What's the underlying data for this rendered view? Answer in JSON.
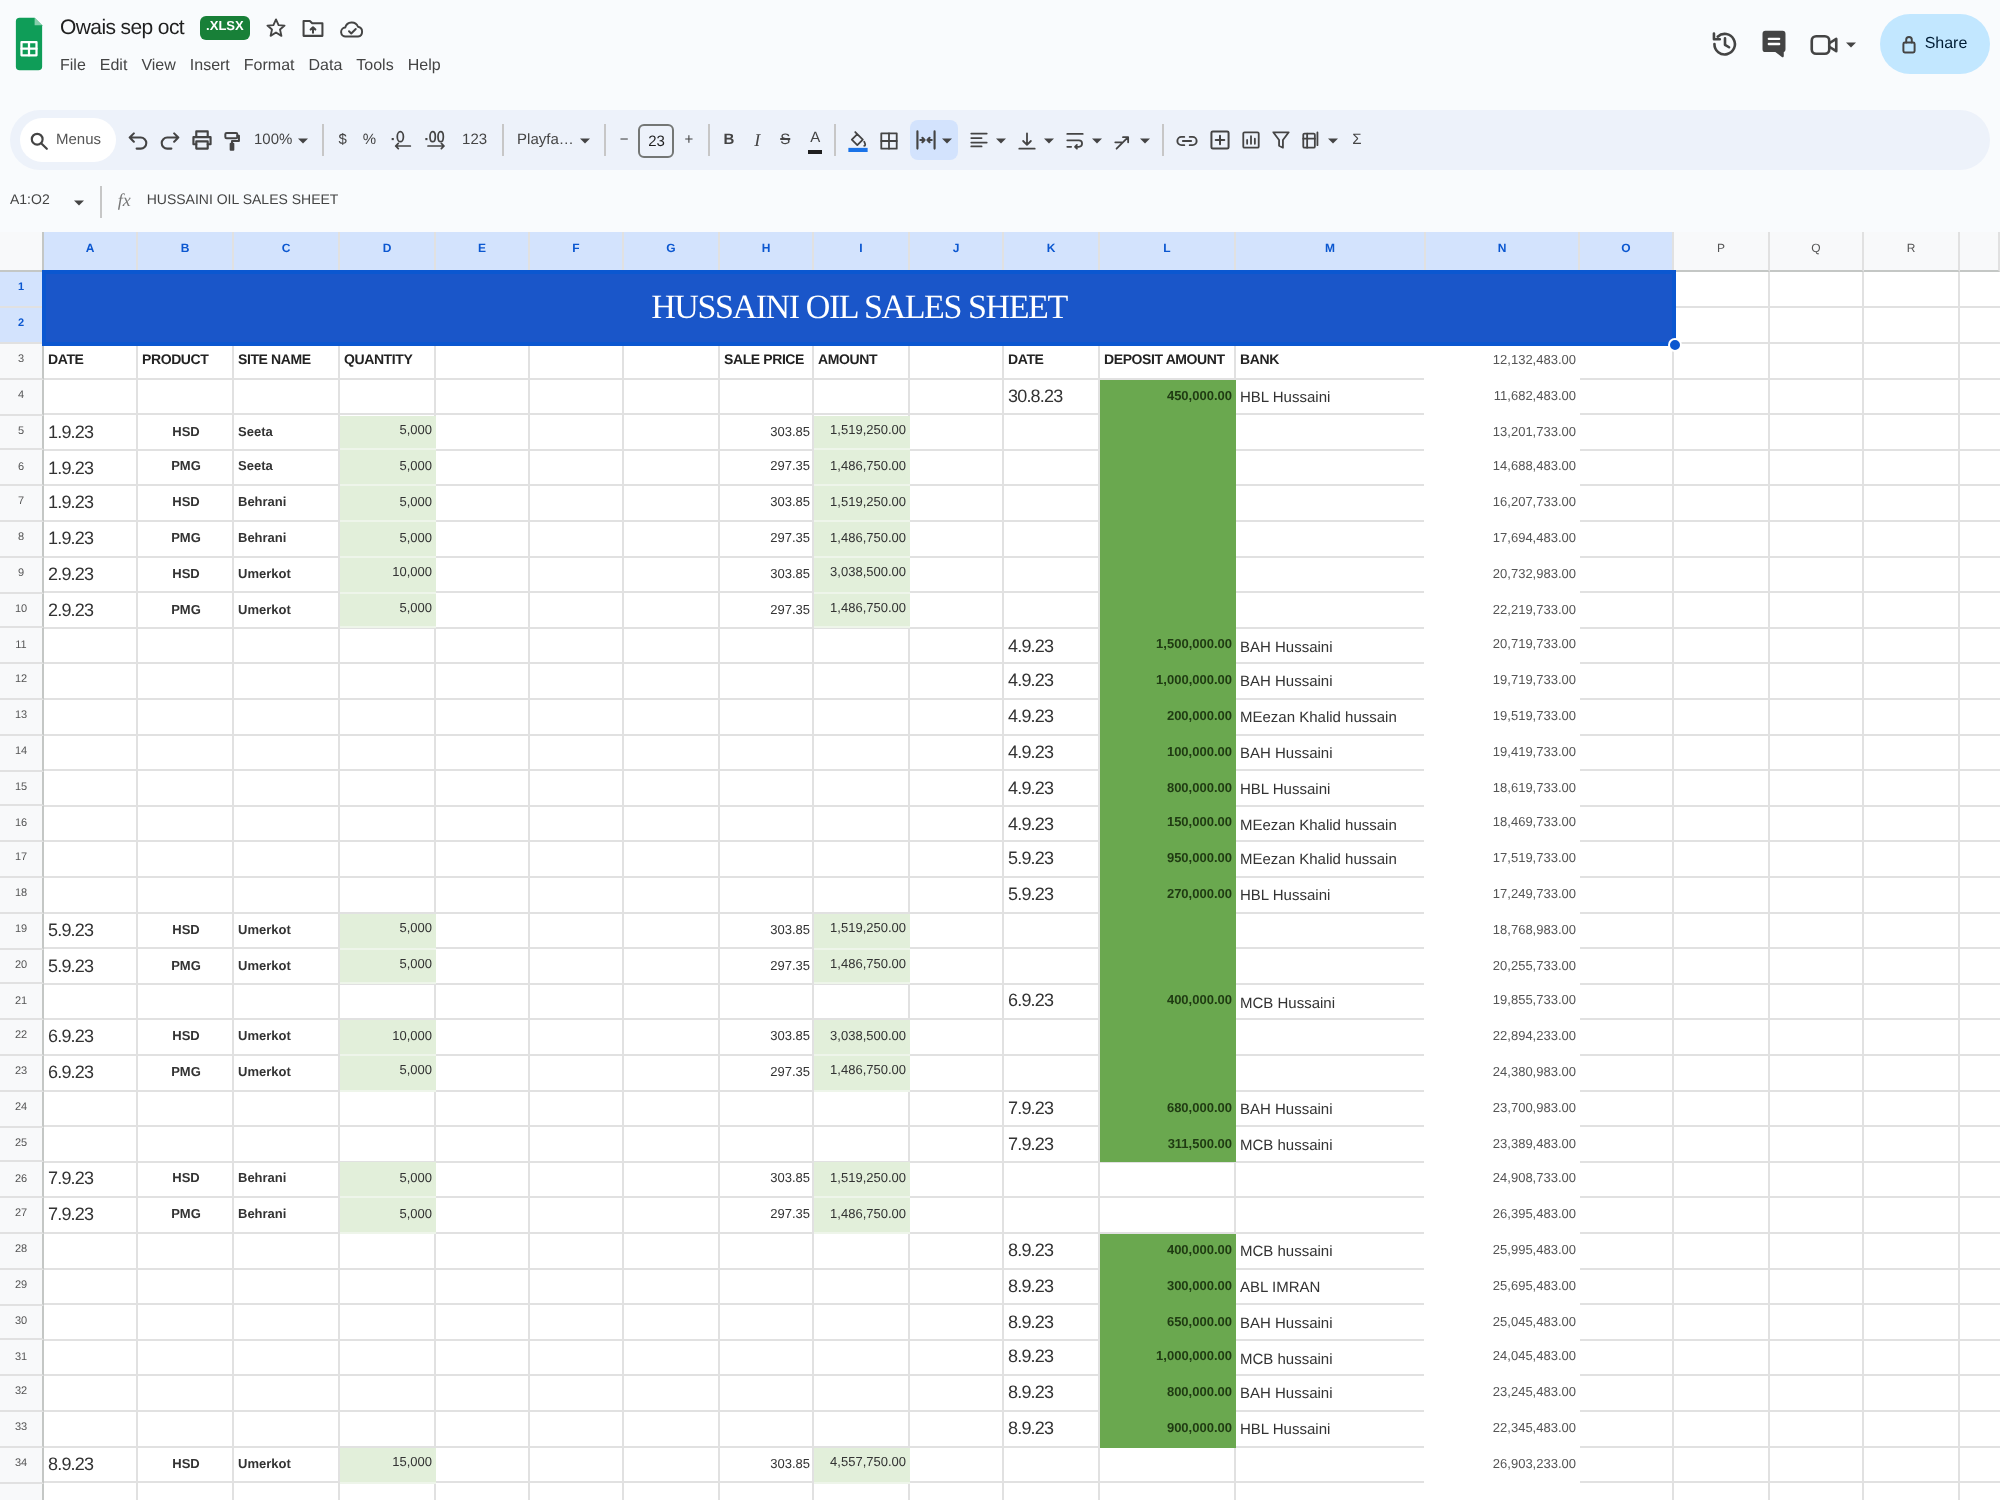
{
  "document": {
    "title": "Owais sep oct",
    "file_type": ".XLSX"
  },
  "menu": [
    "File",
    "Edit",
    "View",
    "Insert",
    "Format",
    "Data",
    "Tools",
    "Help"
  ],
  "share_button": "Share",
  "toolbar": {
    "search": {
      "placeholder": "Menus"
    },
    "zoom": "100%",
    "currency": "$",
    "percent": "%",
    "number_format": "123",
    "font": "Playfa…",
    "font_size": {
      "decrease": "−",
      "value": "23",
      "increase": "+"
    },
    "text_styles": [
      {
        "kind": "bold",
        "label": "B"
      },
      {
        "kind": "italic",
        "label": "I"
      },
      {
        "kind": "strikethrough",
        "label": "S"
      },
      {
        "kind": "text_color",
        "label": "A"
      }
    ],
    "merge": {
      "selected": true
    },
    "sum": "Σ"
  },
  "formula_bar": {
    "cell_range": "A1:O2",
    "fx": "fx",
    "formula": "HUSSAINI OIL SALES SHEET"
  },
  "sheet": {
    "columns": [
      {
        "label": "A",
        "selected": true
      },
      {
        "label": "B",
        "selected": true
      },
      {
        "label": "C",
        "selected": true
      },
      {
        "label": "D",
        "selected": true
      },
      {
        "label": "E",
        "selected": true
      },
      {
        "label": "F",
        "selected": true
      },
      {
        "label": "G",
        "selected": true
      },
      {
        "label": "H",
        "selected": true
      },
      {
        "label": "I",
        "selected": true
      },
      {
        "label": "J",
        "selected": true
      },
      {
        "label": "K",
        "selected": true
      },
      {
        "label": "L",
        "selected": true
      },
      {
        "label": "M",
        "selected": true
      },
      {
        "label": "N",
        "selected": true
      },
      {
        "label": "O",
        "selected": true
      },
      {
        "label": "P",
        "selected": false
      },
      {
        "label": "Q",
        "selected": false
      },
      {
        "label": "R",
        "selected": false
      }
    ],
    "title_band": {
      "text": "HUSSAINI OIL SALES SHEET",
      "selected": true
    },
    "title_rows": [
      {
        "number": "1",
        "selected": true
      },
      {
        "number": "2",
        "selected": true
      }
    ],
    "rows": [
      {
        "number": "3",
        "selected": false,
        "kind": "heading",
        "sale": {
          "date": "DATE",
          "product": "PRODUCT",
          "site": "SITE NAME",
          "quantity": "QUANTITY",
          "sale_price": "SALE PRICE",
          "amount": "AMOUNT"
        },
        "deposit": {
          "date": "DATE",
          "amount": "DEPOSIT AMOUNT",
          "bank": "BANK"
        },
        "deposit_filled": false,
        "balance": "12,132,483.00"
      },
      {
        "number": "4",
        "selected": false,
        "kind": "entry",
        "deposit": {
          "date": "30.8.23",
          "amount": "450,000.00",
          "bank": "HBL Hussaini"
        },
        "deposit_filled": true,
        "balance": "11,682,483.00"
      },
      {
        "number": "5",
        "selected": false,
        "kind": "entry",
        "sale": {
          "date": "1.9.23",
          "product": "HSD",
          "site": "Seeta",
          "quantity": "5,000",
          "sale_price": "303.85",
          "amount": "1,519,250.00"
        },
        "deposit_filled": true,
        "balance": "13,201,733.00"
      },
      {
        "number": "6",
        "selected": false,
        "kind": "entry",
        "sale": {
          "date": "1.9.23",
          "product": "PMG",
          "site": "Seeta",
          "quantity": "5,000",
          "sale_price": "297.35",
          "amount": "1,486,750.00"
        },
        "deposit_filled": true,
        "balance": "14,688,483.00"
      },
      {
        "number": "7",
        "selected": false,
        "kind": "entry",
        "sale": {
          "date": "1.9.23",
          "product": "HSD",
          "site": "Behrani",
          "quantity": "5,000",
          "sale_price": "303.85",
          "amount": "1,519,250.00"
        },
        "deposit_filled": true,
        "balance": "16,207,733.00"
      },
      {
        "number": "8",
        "selected": false,
        "kind": "entry",
        "sale": {
          "date": "1.9.23",
          "product": "PMG",
          "site": "Behrani",
          "quantity": "5,000",
          "sale_price": "297.35",
          "amount": "1,486,750.00"
        },
        "deposit_filled": true,
        "balance": "17,694,483.00"
      },
      {
        "number": "9",
        "selected": false,
        "kind": "entry",
        "sale": {
          "date": "2.9.23",
          "product": "HSD",
          "site": "Umerkot",
          "quantity": "10,000",
          "sale_price": "303.85",
          "amount": "3,038,500.00"
        },
        "deposit_filled": true,
        "balance": "20,732,983.00"
      },
      {
        "number": "10",
        "selected": false,
        "kind": "entry",
        "sale": {
          "date": "2.9.23",
          "product": "PMG",
          "site": "Umerkot",
          "quantity": "5,000",
          "sale_price": "297.35",
          "amount": "1,486,750.00"
        },
        "deposit_filled": true,
        "balance": "22,219,733.00"
      },
      {
        "number": "11",
        "selected": false,
        "kind": "entry",
        "deposit": {
          "date": "4.9.23",
          "amount": "1,500,000.00",
          "bank": "BAH Hussaini"
        },
        "deposit_filled": true,
        "balance": "20,719,733.00"
      },
      {
        "number": "12",
        "selected": false,
        "kind": "entry",
        "deposit": {
          "date": "4.9.23",
          "amount": "1,000,000.00",
          "bank": "BAH Hussaini"
        },
        "deposit_filled": true,
        "balance": "19,719,733.00"
      },
      {
        "number": "13",
        "selected": false,
        "kind": "entry",
        "deposit": {
          "date": "4.9.23",
          "amount": "200,000.00",
          "bank": "MEezan Khalid hussain"
        },
        "deposit_filled": true,
        "balance": "19,519,733.00"
      },
      {
        "number": "14",
        "selected": false,
        "kind": "entry",
        "deposit": {
          "date": "4.9.23",
          "amount": "100,000.00",
          "bank": "BAH Hussaini"
        },
        "deposit_filled": true,
        "balance": "19,419,733.00"
      },
      {
        "number": "15",
        "selected": false,
        "kind": "entry",
        "deposit": {
          "date": "4.9.23",
          "amount": "800,000.00",
          "bank": "HBL Hussaini"
        },
        "deposit_filled": true,
        "balance": "18,619,733.00"
      },
      {
        "number": "16",
        "selected": false,
        "kind": "entry",
        "deposit": {
          "date": "4.9.23",
          "amount": "150,000.00",
          "bank": "MEezan Khalid hussain"
        },
        "deposit_filled": true,
        "balance": "18,469,733.00"
      },
      {
        "number": "17",
        "selected": false,
        "kind": "entry",
        "deposit": {
          "date": "5.9.23",
          "amount": "950,000.00",
          "bank": "MEezan Khalid hussain"
        },
        "deposit_filled": true,
        "balance": "17,519,733.00"
      },
      {
        "number": "18",
        "selected": false,
        "kind": "entry",
        "deposit": {
          "date": "5.9.23",
          "amount": "270,000.00",
          "bank": "HBL Hussaini"
        },
        "deposit_filled": true,
        "balance": "17,249,733.00"
      },
      {
        "number": "19",
        "selected": false,
        "kind": "entry",
        "sale": {
          "date": "5.9.23",
          "product": "HSD",
          "site": "Umerkot",
          "quantity": "5,000",
          "sale_price": "303.85",
          "amount": "1,519,250.00"
        },
        "deposit_filled": true,
        "balance": "18,768,983.00"
      },
      {
        "number": "20",
        "selected": false,
        "kind": "entry",
        "sale": {
          "date": "5.9.23",
          "product": "PMG",
          "site": "Umerkot",
          "quantity": "5,000",
          "sale_price": "297.35",
          "amount": "1,486,750.00"
        },
        "deposit_filled": true,
        "balance": "20,255,733.00"
      },
      {
        "number": "21",
        "selected": false,
        "kind": "entry",
        "deposit": {
          "date": "6.9.23",
          "amount": "400,000.00",
          "bank": "MCB Hussaini"
        },
        "deposit_filled": true,
        "balance": "19,855,733.00"
      },
      {
        "number": "22",
        "selected": false,
        "kind": "entry",
        "sale": {
          "date": "6.9.23",
          "product": "HSD",
          "site": "Umerkot",
          "quantity": "10,000",
          "sale_price": "303.85",
          "amount": "3,038,500.00"
        },
        "deposit_filled": true,
        "balance": "22,894,233.00"
      },
      {
        "number": "23",
        "selected": false,
        "kind": "entry",
        "sale": {
          "date": "6.9.23",
          "product": "PMG",
          "site": "Umerkot",
          "quantity": "5,000",
          "sale_price": "297.35",
          "amount": "1,486,750.00"
        },
        "deposit_filled": true,
        "balance": "24,380,983.00"
      },
      {
        "number": "24",
        "selected": false,
        "kind": "entry",
        "deposit": {
          "date": "7.9.23",
          "amount": "680,000.00",
          "bank": "BAH Hussaini"
        },
        "deposit_filled": true,
        "balance": "23,700,983.00"
      },
      {
        "number": "25",
        "selected": false,
        "kind": "entry",
        "deposit": {
          "date": "7.9.23",
          "amount": "311,500.00",
          "bank": "MCB hussaini"
        },
        "deposit_filled": true,
        "balance": "23,389,483.00"
      },
      {
        "number": "26",
        "selected": false,
        "kind": "entry",
        "sale": {
          "date": "7.9.23",
          "product": "HSD",
          "site": "Behrani",
          "quantity": "5,000",
          "sale_price": "303.85",
          "amount": "1,519,250.00"
        },
        "deposit_filled": false,
        "balance": "24,908,733.00"
      },
      {
        "number": "27",
        "selected": false,
        "kind": "entry",
        "sale": {
          "date": "7.9.23",
          "product": "PMG",
          "site": "Behrani",
          "quantity": "5,000",
          "sale_price": "297.35",
          "amount": "1,486,750.00"
        },
        "deposit_filled": false,
        "balance": "26,395,483.00"
      },
      {
        "number": "28",
        "selected": false,
        "kind": "entry",
        "deposit": {
          "date": "8.9.23",
          "amount": "400,000.00",
          "bank": "MCB hussaini"
        },
        "deposit_filled": true,
        "balance": "25,995,483.00"
      },
      {
        "number": "29",
        "selected": false,
        "kind": "entry",
        "deposit": {
          "date": "8.9.23",
          "amount": "300,000.00",
          "bank": "ABL IMRAN"
        },
        "deposit_filled": true,
        "balance": "25,695,483.00"
      },
      {
        "number": "30",
        "selected": false,
        "kind": "entry",
        "deposit": {
          "date": "8.9.23",
          "amount": "650,000.00",
          "bank": "BAH Hussaini"
        },
        "deposit_filled": true,
        "balance": "25,045,483.00"
      },
      {
        "number": "31",
        "selected": false,
        "kind": "entry",
        "deposit": {
          "date": "8.9.23",
          "amount": "1,000,000.00",
          "bank": "MCB hussaini"
        },
        "deposit_filled": true,
        "balance": "24,045,483.00"
      },
      {
        "number": "32",
        "selected": false,
        "kind": "entry",
        "deposit": {
          "date": "8.9.23",
          "amount": "800,000.00",
          "bank": "BAH Hussaini"
        },
        "deposit_filled": true,
        "balance": "23,245,483.00"
      },
      {
        "number": "33",
        "selected": false,
        "kind": "entry",
        "deposit": {
          "date": "8.9.23",
          "amount": "900,000.00",
          "bank": "HBL Hussaini"
        },
        "deposit_filled": true,
        "balance": "22,345,483.00"
      },
      {
        "number": "34",
        "selected": false,
        "kind": "entry",
        "sale": {
          "date": "8.9.23",
          "product": "HSD",
          "site": "Umerkot",
          "quantity": "15,000",
          "sale_price": "303.85",
          "amount": "4,557,750.00"
        },
        "deposit_filled": false,
        "balance": "26,903,233.00"
      }
    ]
  }
}
